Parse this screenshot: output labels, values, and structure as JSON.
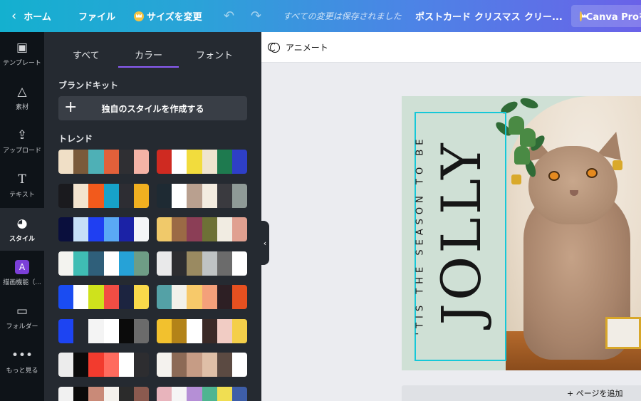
{
  "topbar": {
    "back_label": "ホーム",
    "file_label": "ファイル",
    "resize_label": "サイズを変更",
    "saved_status": "すべての変更は保存されました",
    "tags": [
      "ポストカード",
      "クリスマス",
      "クリー..."
    ],
    "pro_label": "Canva Proを"
  },
  "rail": {
    "items": [
      {
        "label": "テンプレート",
        "icon": "layout-icon"
      },
      {
        "label": "素材",
        "icon": "shapes-icon"
      },
      {
        "label": "アップロード",
        "icon": "upload-icon"
      },
      {
        "label": "テキスト",
        "icon": "text-icon"
      },
      {
        "label": "スタイル",
        "icon": "palette-icon",
        "active": true
      },
      {
        "label": "描画機能（...",
        "icon": "draw-icon"
      },
      {
        "label": "フォルダー",
        "icon": "folder-icon"
      },
      {
        "label": "もっと見る",
        "icon": "more-icon"
      }
    ]
  },
  "panel": {
    "tabs": [
      "すべて",
      "カラー",
      "フォント"
    ],
    "active_tab": "カラー",
    "brand_kit_title": "ブランドキット",
    "create_style_label": "独自のスタイルを作成する",
    "trend_title": "トレンド",
    "palettes": [
      [
        "#f0dfc6",
        "#7a5a3a",
        "#4eb0b6",
        "#e2603a",
        "#2f2f33",
        "#f4b3a6"
      ],
      [
        "#cf2a21",
        "#ffffff",
        "#f2dc3d",
        "#efe4cf",
        "#1e7a4f",
        "#2e3fc7"
      ],
      [
        "#1a1a1e",
        "#f3e4cf",
        "#f25a1c",
        "#17a2c9",
        "#2d2d33",
        "#f1b020"
      ],
      [
        "#1e2a33",
        "#ffffff",
        "#b9a08f",
        "#f3ece0",
        "#3a3a3f",
        "#8f9a97"
      ],
      [
        "#0a0f3d",
        "#c6dff7",
        "#1f3ff2",
        "#5aa9f5",
        "#1b22a6",
        "#f4f5f7"
      ],
      [
        "#f0c96a",
        "#9b6a45",
        "#8b3e56",
        "#6d7136",
        "#f1ece2",
        "#e0a090"
      ],
      [
        "#f3f3ef",
        "#3fbdb4",
        "#2f5f7a",
        "#ffffff",
        "#26a2d7",
        "#6e9d86"
      ],
      [
        "#e9e9ea",
        "#2d2d30",
        "#9a8a61",
        "#bfc3c4",
        "#6b6b6b",
        "#ffffff"
      ],
      [
        "#1a4cf2",
        "#ffffff",
        "#cfe21c",
        "#f24d44",
        "#1c2440",
        "#f9d94a"
      ],
      [
        "#54a1a6",
        "#f2f1ea",
        "#f7c96a",
        "#f4a07a",
        "#2d1f24",
        "#e65020"
      ],
      [
        "#1d44f2",
        "#252a31",
        "#f4f4f4",
        "#ffffff",
        "#0b0b0b",
        "#6b6b6b"
      ],
      [
        "#f2c12e",
        "#b38318",
        "#ffffff",
        "#3a2a27",
        "#f1ccc4",
        "#f4cf4a"
      ],
      [
        "#ececec",
        "#0a0a0a",
        "#f23b2e",
        "#ff6b5e",
        "#ffffff",
        "#2d2d30"
      ],
      [
        "#f4f2ee",
        "#8c6a56",
        "#c69c85",
        "#dfbfa7",
        "#5b4a42",
        "#ffffff"
      ],
      [
        "#f1f1f1",
        "#0a0a0a",
        "#c98a78",
        "#f4f1ec",
        "#2b2b2b",
        "#8b5a4f"
      ],
      [
        "#e8b4bc",
        "#f5f5f5",
        "#b58fd6",
        "#4fb591",
        "#f0de52",
        "#3e5ea8"
      ]
    ]
  },
  "canvas": {
    "animate_label": "アニメート",
    "design_text_main": "JOLLY",
    "design_text_sub": "'TIS THE SEASON TO BE",
    "add_page_label": "+ ページを追加"
  },
  "colors": {
    "accent_purple": "#8b5cf6",
    "selection_cyan": "#16c8d8",
    "panel_bg": "#252a31",
    "rail_bg": "#0e1318"
  }
}
